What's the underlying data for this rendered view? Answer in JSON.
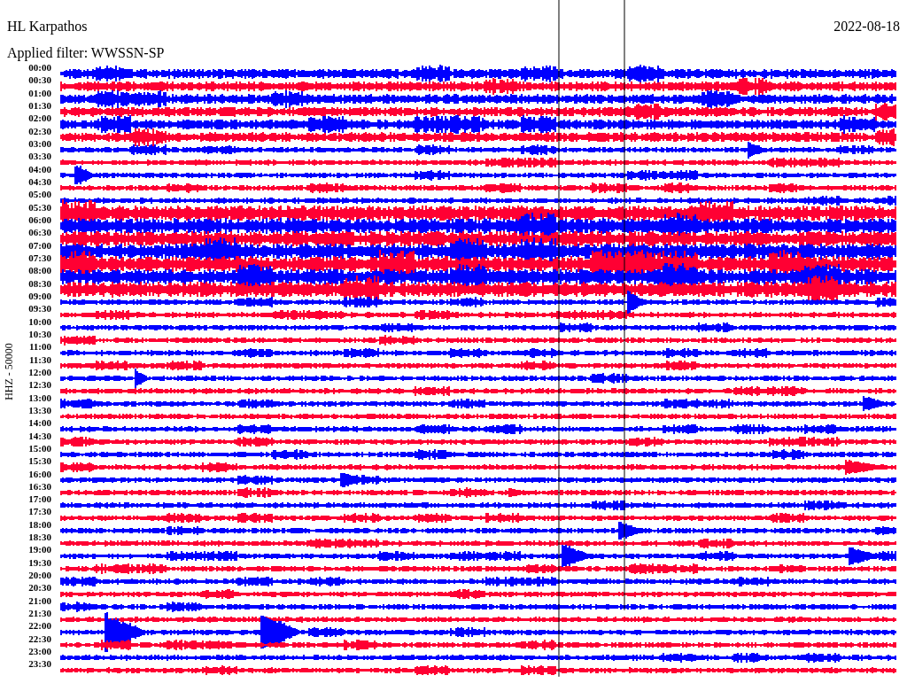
{
  "station": "HL Karpathos",
  "date": "2022-08-18",
  "filter": "Applied filter: WWSSN-SP",
  "axis_label": "HHZ - 50000",
  "rows": [
    {
      "time": "00:00",
      "color": "#0000ff"
    },
    {
      "time": "00:30",
      "color": "#ff0033"
    },
    {
      "time": "01:00",
      "color": "#0000ff"
    },
    {
      "time": "01:30",
      "color": "#ff0033"
    },
    {
      "time": "02:00",
      "color": "#0000ff"
    },
    {
      "time": "02:30",
      "color": "#ff0033"
    },
    {
      "time": "03:00",
      "color": "#0000ff"
    },
    {
      "time": "03:30",
      "color": "#ff0033"
    },
    {
      "time": "04:00",
      "color": "#0000ff"
    },
    {
      "time": "04:30",
      "color": "#ff0033"
    },
    {
      "time": "05:00",
      "color": "#0000ff"
    },
    {
      "time": "05:30",
      "color": "#ff0033"
    },
    {
      "time": "06:00",
      "color": "#0000ff"
    },
    {
      "time": "06:30",
      "color": "#ff0033"
    },
    {
      "time": "07:00",
      "color": "#0000ff"
    },
    {
      "time": "07:30",
      "color": "#ff0033"
    },
    {
      "time": "08:00",
      "color": "#0000ff"
    },
    {
      "time": "08:30",
      "color": "#ff0033"
    },
    {
      "time": "09:00",
      "color": "#0000ff"
    },
    {
      "time": "09:30",
      "color": "#ff0033"
    },
    {
      "time": "10:00",
      "color": "#0000ff"
    },
    {
      "time": "10:30",
      "color": "#ff0033"
    },
    {
      "time": "11:00",
      "color": "#0000ff"
    },
    {
      "time": "11:30",
      "color": "#ff0033"
    },
    {
      "time": "12:00",
      "color": "#0000ff"
    },
    {
      "time": "12:30",
      "color": "#ff0033"
    },
    {
      "time": "13:00",
      "color": "#0000ff"
    },
    {
      "time": "13:30",
      "color": "#ff0033"
    },
    {
      "time": "14:00",
      "color": "#0000ff"
    },
    {
      "time": "14:30",
      "color": "#ff0033"
    },
    {
      "time": "15:00",
      "color": "#0000ff"
    },
    {
      "time": "15:30",
      "color": "#ff0033"
    },
    {
      "time": "16:00",
      "color": "#0000ff"
    },
    {
      "time": "16:30",
      "color": "#ff0033"
    },
    {
      "time": "17:00",
      "color": "#0000ff"
    },
    {
      "time": "17:30",
      "color": "#ff0033"
    },
    {
      "time": "18:00",
      "color": "#0000ff"
    },
    {
      "time": "18:30",
      "color": "#ff0033"
    },
    {
      "time": "19:00",
      "color": "#0000ff"
    },
    {
      "time": "19:30",
      "color": "#ff0033"
    },
    {
      "time": "20:00",
      "color": "#0000ff"
    },
    {
      "time": "20:30",
      "color": "#ff0033"
    },
    {
      "time": "21:00",
      "color": "#0000ff"
    },
    {
      "time": "21:30",
      "color": "#ff0033"
    },
    {
      "time": "22:00",
      "color": "#0000ff"
    },
    {
      "time": "22:30",
      "color": "#ff0033"
    },
    {
      "time": "23:00",
      "color": "#0000ff"
    },
    {
      "time": "23:30",
      "color": "#ff0033"
    }
  ]
}
